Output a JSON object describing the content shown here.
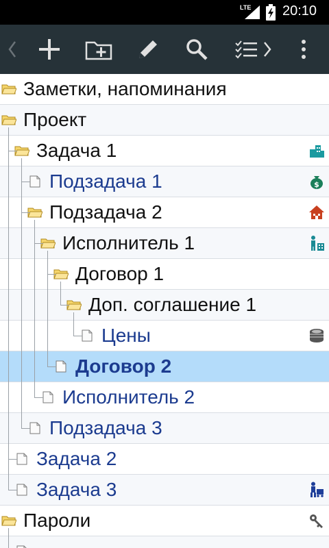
{
  "status": {
    "network": "LTE",
    "time": "20:10"
  },
  "toolbar": {
    "back_icon": "chevron-left-icon",
    "add_icon": "plus-icon",
    "add_folder_icon": "folder-plus-icon",
    "edit_icon": "pencil-icon",
    "search_icon": "search-icon",
    "checklist_icon": "checklist-chevron-icon",
    "menu_icon": "more-vert-icon"
  },
  "tree": [
    {
      "label": "Заметки, напоминания",
      "kind": "folder"
    },
    {
      "label": "Проект",
      "kind": "folder"
    },
    {
      "label": "Задача 1",
      "kind": "folder",
      "right_icon": "buildings-icon"
    },
    {
      "label": "Подзадача 1",
      "kind": "note",
      "right_icon": "money-bag-icon"
    },
    {
      "label": "Подзадача 2",
      "kind": "folder",
      "right_icon": "house-icon"
    },
    {
      "label": "Исполнитель 1",
      "kind": "folder",
      "right_icon": "worker-icon"
    },
    {
      "label": "Договор 1",
      "kind": "folder"
    },
    {
      "label": "Доп. соглашение 1",
      "kind": "folder"
    },
    {
      "label": "Цены",
      "kind": "note",
      "right_icon": "coins-icon"
    },
    {
      "label": "Договор 2",
      "kind": "note",
      "selected": true
    },
    {
      "label": "Исполнитель 2",
      "kind": "note"
    },
    {
      "label": "Подзадача 3",
      "kind": "note"
    },
    {
      "label": "Задача 2",
      "kind": "note"
    },
    {
      "label": "Задача 3",
      "kind": "note",
      "right_icon": "delivery-icon"
    },
    {
      "label": "Пароли",
      "kind": "folder",
      "right_icon": "key-icon"
    },
    {
      "label": "",
      "kind": "note"
    }
  ],
  "colors": {
    "toolbar_bg": "#263238",
    "selected_row": "#b4dcfa",
    "note_text": "#1b3b8f",
    "folder_fill": "#f5d56b"
  }
}
